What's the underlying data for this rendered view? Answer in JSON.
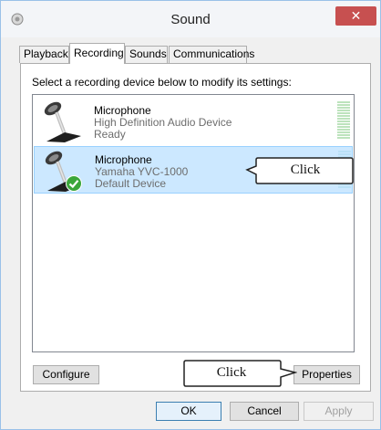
{
  "window": {
    "title": "Sound",
    "close_label": "✕"
  },
  "tabs": [
    {
      "label": "Playback"
    },
    {
      "label": "Recording",
      "active": true
    },
    {
      "label": "Sounds"
    },
    {
      "label": "Communications"
    }
  ],
  "instruction": "Select a recording device below to modify its settings:",
  "devices": [
    {
      "name": "Microphone",
      "description": "High Definition Audio Device",
      "status": "Ready",
      "icon": "microphone-icon",
      "selected": false
    },
    {
      "name": "Microphone",
      "description": "Yamaha YVC-1000",
      "status": "Default Device",
      "icon": "microphone-default-icon",
      "selected": true
    }
  ],
  "buttons": {
    "configure": "Configure",
    "properties": "Properties",
    "ok": "OK",
    "cancel": "Cancel",
    "apply": "Apply"
  },
  "callouts": [
    {
      "text": "Click"
    },
    {
      "text": "Click"
    }
  ],
  "colors": {
    "selected_bg": "#cce8ff",
    "close_bg": "#c75050",
    "level_green": "#bde3bd"
  }
}
